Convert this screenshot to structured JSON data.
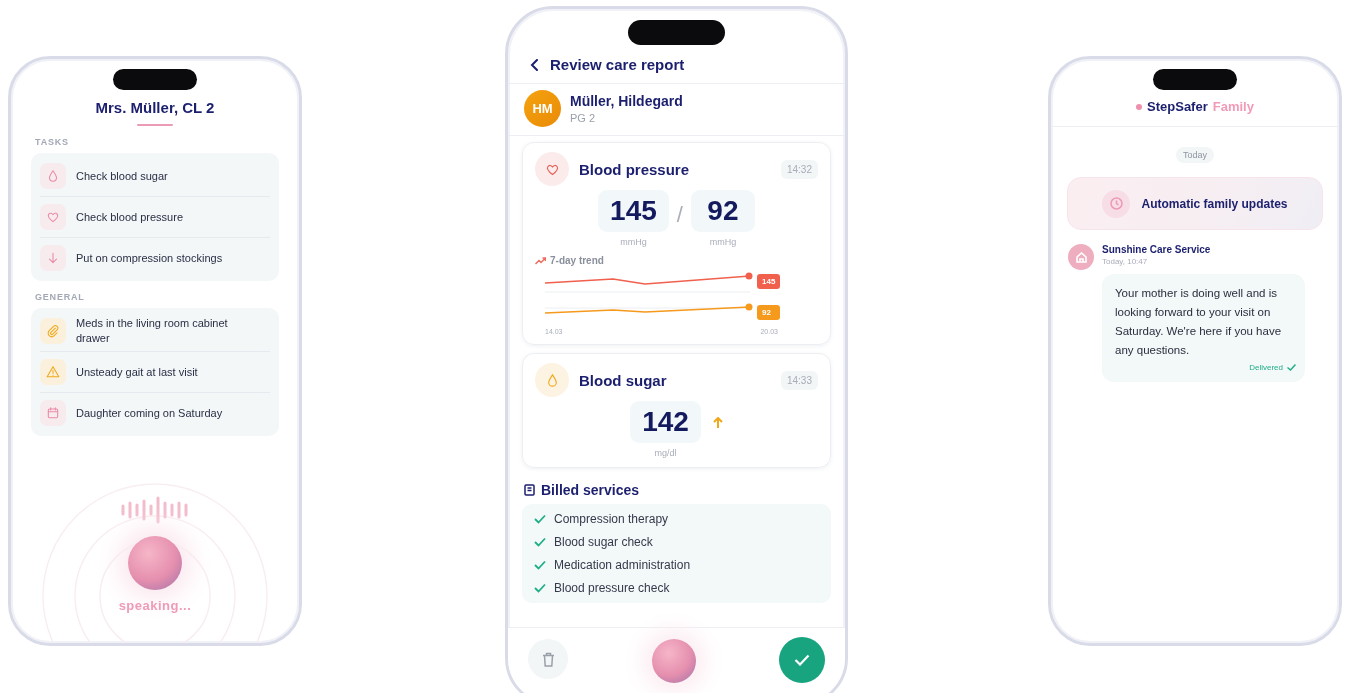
{
  "care_notes_screen": {
    "title": "Mrs. Müller, CL 2",
    "sections": [
      {
        "heading": "TASKS",
        "items": [
          {
            "kind": "drop",
            "text": "Check blood sugar"
          },
          {
            "kind": "heart",
            "text": "Check blood pressure"
          },
          {
            "kind": "arrow-down",
            "text": "Put on compression stockings"
          }
        ]
      },
      {
        "heading": "GENERAL",
        "items": [
          {
            "kind": "paperclip",
            "text": "Meds in the living room cabinet drawer"
          },
          {
            "kind": "warning",
            "text": "Unsteady gait at last visit"
          },
          {
            "kind": "calendar",
            "text": "Daughter coming on Saturday"
          }
        ]
      }
    ],
    "voice_status": "speaking..."
  },
  "care_report_screen": {
    "title": "Review care report",
    "patient": {
      "initials": "HM",
      "name": "Müller, Hildegard",
      "care_level": "PG 2"
    },
    "vitals": [
      {
        "kind": "pressure",
        "title": "Blood pressure",
        "time": "14:32",
        "separator": "/",
        "rising": false,
        "readings": [
          {
            "value": "145",
            "unit": "mmHg"
          },
          {
            "value": "92",
            "unit": "mmHg"
          }
        ],
        "trend": {
          "label": "7-day trend",
          "end_labels": [
            "145",
            "92"
          ],
          "start_date": "14.03",
          "end_date": "20.03"
        }
      },
      {
        "kind": "sugar",
        "title": "Blood sugar",
        "time": "14:33",
        "rising": true,
        "readings": [
          {
            "value": "142",
            "unit": "mg/dl"
          }
        ]
      }
    ],
    "billed_services": {
      "title": "Billed services",
      "items": [
        "Compression therapy",
        "Blood sugar check",
        "Medication administration",
        "Blood pressure check"
      ]
    }
  },
  "family_screen": {
    "brand_name": "StepSafer",
    "brand_suffix": "Family",
    "date_chip": "Today",
    "banner": "Automatic family updates",
    "message": {
      "sender": "Sunshine Care Service",
      "time": "Today, 10:47",
      "text": "Your mother is doing well and is looking forward to your visit on Saturday. We're here if you have any questions.",
      "status": "Delivered"
    }
  }
}
